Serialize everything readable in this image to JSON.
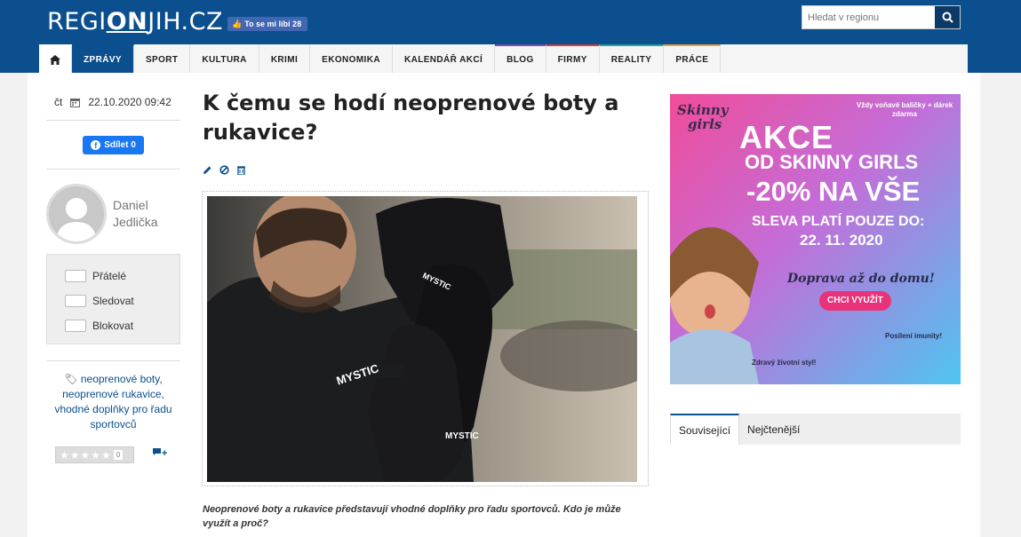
{
  "header": {
    "logo_prefix": "REGI",
    "logo_bold": "ON",
    "logo_suffix": "JIH.CZ",
    "like_label": "To se mi líbí 28",
    "search_placeholder": "Hledat v regionu"
  },
  "nav": {
    "items": [
      "ZPRÁVY",
      "SPORT",
      "KULTURA",
      "KRIMI",
      "EKONOMIKA",
      "KALENDÁŘ AKCÍ",
      "BLOG",
      "FIRMY",
      "REALITY",
      "PRÁCE"
    ],
    "accent_colors": [
      "#0b4f8e",
      "#f5f5f5",
      "#f5f5f5",
      "#f5f5f5",
      "#f5f5f5",
      "#f5f5f5",
      "#7b4fa6",
      "#d93a3a",
      "#2aa3a0",
      "#e8a33a"
    ],
    "active": "ZPRÁVY"
  },
  "sidebar": {
    "day": "čt",
    "date": "22.10.2020 09:42",
    "share_label": "Sdílet 0",
    "author_first": "Daniel",
    "author_last": "Jedlička",
    "toggles": [
      "Přátelé",
      "Sledovat",
      "Blokovat"
    ],
    "tags": "neoprenové boty, neoprenové rukavice, vhodné doplňky pro řadu sportovců",
    "rating_count": "0",
    "rating_stars": 0
  },
  "article": {
    "title": "K čemu se hodí neoprenové boty a rukavice?",
    "photo_brand": "MYSTIC",
    "perex": "Neoprenové boty a rukavice představují vhodné doplňky pro řadu sportovců. Kdo je může využít a proč?"
  },
  "ad": {
    "brand_line1": "Skinny",
    "brand_line2": "girls",
    "gift_note": "Vždy voňavé balíčky + dárek zdarma",
    "headline": "AKCE",
    "subline": "OD SKINNY GIRLS",
    "discount": "-20% NA VŠE",
    "validity": "SLEVA PLATÍ POUZE DO:",
    "date": "22. 11. 2020",
    "delivery": "Doprava až do domu!",
    "cta": "CHCI VYUŽÍT",
    "immunity": "Posílení imunity!",
    "lifestyle": "Zdravý životní styl!"
  },
  "tabs": [
    "Související",
    "Nejčtenější"
  ],
  "colors": {
    "brand_blue": "#0b4f8e",
    "facebook": "#1877f2"
  }
}
